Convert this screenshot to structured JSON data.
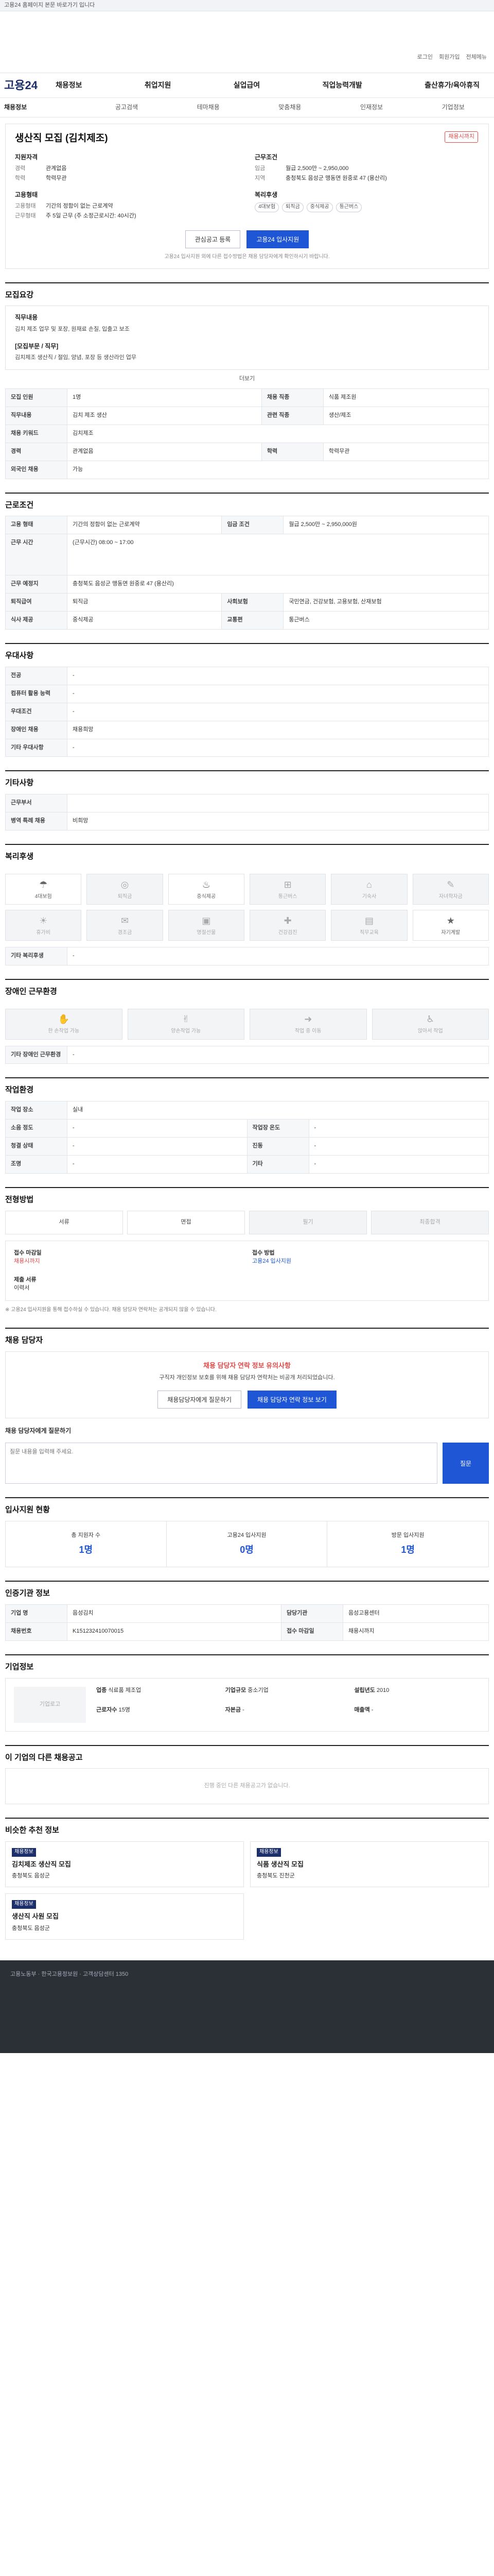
{
  "topbar": {
    "text": "고용24 홈페이지 본문 바로가기 입니다"
  },
  "util": [
    "로그인",
    "회원가입",
    "전체메뉴"
  ],
  "gnb": {
    "logo": "고용24",
    "items": [
      "채용정보",
      "취업지원",
      "실업급여",
      "직업능력개발",
      "출산휴가/육아휴직"
    ]
  },
  "subnav": [
    "채용정보",
    "공고검색",
    "테마채용",
    "맞춤채용",
    "인재정보",
    "기업정보"
  ],
  "job": {
    "title": "생산직 모집 (김치제조)",
    "status": "채용시까지",
    "left_h": "지원자격",
    "career_label": "경력",
    "career": "관계없음",
    "edu_label": "학력",
    "edu": "학력무관",
    "cond_h": "고용형태",
    "emptype_label": "고용형태",
    "emptype": "기간의 정함이 없는 근로계약",
    "worktime_label": "근무형태",
    "worktime": "주 5일 근무 (주 소정근로시간: 40시간)",
    "right_h": "근무조건",
    "wage_label": "임금",
    "wage": "월급 2,500만 ~ 2,950,000",
    "loc_label": "지역",
    "loc": "충청북도 음성군 맹동면 원중로 47 (용산리)",
    "ben_h": "복리후생",
    "benefits": [
      "4대보험",
      "퇴직금",
      "중식제공",
      "통근버스"
    ],
    "btn_scrap": "관심공고 등록",
    "btn_apply": "고용24 입사지원",
    "note": "고용24 입사지원 외에 다른 접수방법은 채용 담당자에게 확인하시기 바랍니다."
  },
  "s_recruit": {
    "h": "모집요강",
    "box_h": "직무내용",
    "box_text": "김치 제조 업무 및 포장, 원재료 손질, 입출고 보조",
    "box_h2": "[모집부문 / 직무]",
    "box_text2": "김치제조 생산직 / 절임, 양념, 포장 등 생산라인 업무",
    "more": "더보기",
    "rows": [
      [
        "모집 인원",
        "1명",
        "채용 직종",
        "식품 제조원"
      ],
      [
        "직무내용",
        "김치 제조 생산",
        "관련 직종",
        "생산/제조"
      ],
      [
        "채용 키워드",
        "김치제조",
        "",
        ""
      ],
      [
        "경력",
        "관계없음",
        "학력",
        "학력무관"
      ],
      [
        "외국인 채용",
        "가능",
        "",
        ""
      ]
    ]
  },
  "s_cond": {
    "h": "근로조건",
    "rows": [
      [
        "고용 형태",
        "기간의 정함이 없는 근로계약",
        "임금 조건",
        "월급 2,500만 ~ 2,950,000원"
      ],
      [
        "근무 시간",
        "(근무시간) 08:00 ~ 17:00",
        "",
        ""
      ],
      [
        "근무 예정지",
        "충청북도 음성군 맹동면 원중로 47 (용산리)",
        "",
        ""
      ],
      [
        "퇴직급여",
        "퇴직금",
        "사회보험",
        "국민연금, 건강보험, 고용보험, 산재보험"
      ],
      [
        "식사 제공",
        "중식제공",
        "교통편",
        "통근버스"
      ]
    ]
  },
  "s_welfare": {
    "h": "우대사항",
    "rows": [
      [
        "전공",
        "-"
      ],
      [
        "컴퓨터 활용 능력",
        "-"
      ],
      [
        "우대조건",
        "-"
      ],
      [
        "장애인 채용",
        "채용희망"
      ],
      [
        "기타 우대사항",
        "-"
      ]
    ]
  },
  "s_etc": {
    "h": "기타사항",
    "rows": [
      [
        "근무부서",
        ""
      ],
      [
        "병역 특례 채용",
        "비희망"
      ]
    ]
  },
  "s_env": {
    "h": "복리후생",
    "icons": [
      "4대보험",
      "퇴직금",
      "중식제공",
      "통근버스",
      "기숙사",
      "자녀학자금"
    ],
    "icons2": [
      "휴가비",
      "경조금",
      "명절선물",
      "건강검진",
      "직무교육",
      "자기계발"
    ],
    "etc_label": "기타 복리후생",
    "etc_val": "-"
  },
  "s_disab": {
    "h": "장애인 근무환경",
    "icons": [
      "한 손작업 가능",
      "양손작업 가능",
      "작업 중 이동",
      "앉아서 작업"
    ],
    "etc_label": "기타 장애인 근무환경",
    "etc_val": "-"
  },
  "s_place": {
    "h": "작업환경",
    "rows": [
      [
        "작업 장소",
        "실내",
        "",
        "",
        ""
      ],
      [
        "소음 정도",
        "-",
        "작업장 온도",
        "-"
      ],
      [
        "청결 상태",
        "-",
        "진동",
        "-"
      ],
      [
        "조명",
        "-",
        "기타",
        "-"
      ]
    ]
  },
  "s_proc": {
    "h": "전형방법",
    "steps": [
      "서류",
      "면접",
      "필기",
      "최종합격"
    ],
    "apply_h": "접수 마감일",
    "apply_val": "채용시까지",
    "method_h": "접수 방법",
    "method_val": "고용24 입사지원",
    "docs_h": "제출 서류",
    "docs_val": "이력서",
    "notes": "※ 고용24 입사지원을 통해 접수하실 수 있습니다. 채용 담당자 연락처는 공개되지 않을 수 있습니다."
  },
  "s_contact": {
    "h": "채용 담당자",
    "warn_h": "채용 담당자 연락 정보 유의사항",
    "warn_text": "구직자 개인정보 보호를 위해 채용 담당자 연락처는 비공개 처리되었습니다.",
    "btn1": "채용담당자에게 질문하기",
    "btn2": "채용 담당자 연락 정보 보기",
    "q_h": "채용 담당자에게 질문하기",
    "q_placeholder": "질문 내용을 입력해 주세요.",
    "q_send": "질문"
  },
  "s_stats": {
    "h": "입사지원 현황",
    "labels": [
      "총 지원자 수",
      "고용24 입사지원",
      "방문 입사지원"
    ],
    "values": [
      "1명",
      "0명",
      "1명"
    ]
  },
  "s_agency": {
    "h": "인증기관 정보",
    "rows": [
      [
        "기업 명",
        "음성김치",
        "담당기관",
        "음성고용센터"
      ],
      [
        "채용번호",
        "K151232410070015",
        "접수 마감일",
        "채용시까지"
      ]
    ]
  },
  "s_corp": {
    "h": "기업정보",
    "logo_alt": "기업로고",
    "items": [
      [
        "업종",
        "식료품 제조업"
      ],
      [
        "기업규모",
        "중소기업"
      ],
      [
        "설립년도",
        "2010"
      ],
      [
        "근로자수",
        "15명"
      ],
      [
        "자본금",
        "-"
      ],
      [
        "매출액",
        "-"
      ]
    ]
  },
  "s_other": {
    "h": "이 기업의 다른 채용공고",
    "empty": "진행 중인 다른 채용공고가 없습니다."
  },
  "s_related": {
    "h": "비슷한 추천 정보",
    "cards": [
      {
        "badge": "채용정보",
        "title": "김치제조 생산직 모집",
        "place": "충청북도 음성군"
      },
      {
        "badge": "채용정보",
        "title": "식품 생산직 모집",
        "place": "충청북도 진천군"
      },
      {
        "badge": "채용정보",
        "title": "생산직 사원 모집",
        "place": "충청북도 음성군"
      }
    ]
  },
  "footer": "고용노동부 · 한국고용정보원 · 고객상담센터 1350"
}
